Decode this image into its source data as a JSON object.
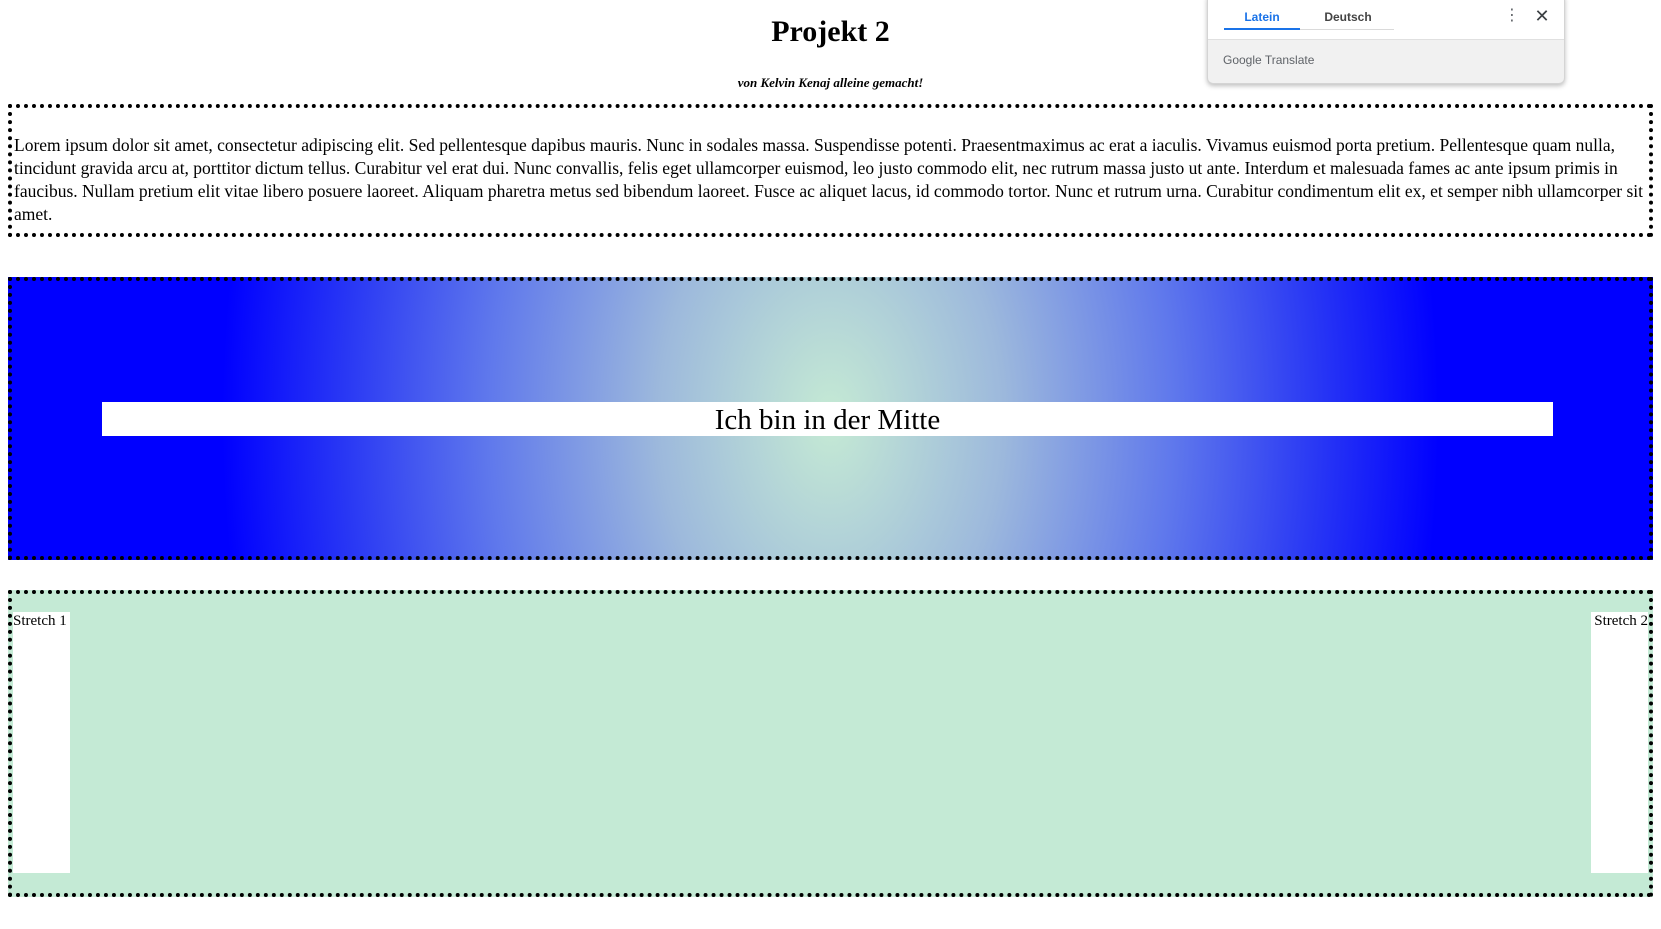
{
  "header": {
    "title": "Projekt 2",
    "subtitle": "von Kelvin Kenaj alleine gemacht!"
  },
  "text_section": {
    "paragraph": "Lorem ipsum dolor sit amet, consectetur adipiscing elit. Sed pellentesque dapibus mauris. Nunc in sodales massa. Suspendisse potenti. Praesentmaximus ac erat a iaculis. Vivamus euismod porta pretium. Pellentesque quam nulla, tincidunt gravida arcu at, porttitor dictum tellus. Curabitur vel erat dui. Nunc convallis, felis eget ullamcorper euismod, leo justo commodo elit, nec rutrum massa justo ut ante. Interdum et malesuada fames ac ante ipsum primis in faucibus. Nullam pretium elit vitae libero posuere laoreet. Aliquam pharetra metus sed bibendum laoreet. Fusce ac aliquet lacus, id commodo tortor. Nunc et rutrum urna. Curabitur condimentum elit ex, et semper nibh ullamcorper sit amet."
  },
  "gradient_section": {
    "center_text": "Ich bin in der Mitte"
  },
  "stretch_section": {
    "item_1": "Stretch 1",
    "item_2": "Stretch 2"
  },
  "translate_popup": {
    "tabs": [
      {
        "label": "Latein",
        "active": true
      },
      {
        "label": "Deutsch",
        "active": false
      }
    ],
    "brand": "Google Translate",
    "menu_icon": "more-vert-icon",
    "close_icon": "close-icon"
  },
  "colors": {
    "accent": "#1a73e8",
    "gradient_center": "#c5ead4",
    "gradient_edge": "#0000ff",
    "stretch_background": "#c4ead5"
  }
}
